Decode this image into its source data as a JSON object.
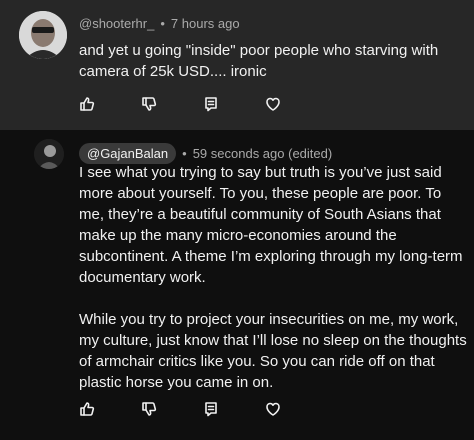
{
  "comments": [
    {
      "username": "@shooterhr_",
      "time": "7 hours ago",
      "paragraphs": [
        "and yet u going \"inside\" poor people who starving with camera of 25k USD.... ironic"
      ],
      "actions": [
        "like-icon",
        "dislike-icon",
        "reply-icon",
        "heart-icon"
      ]
    },
    {
      "username": "@GajanBalan",
      "time": "59 seconds ago (edited)",
      "paragraphs": [
        "I see what you trying to say but truth is you’ve just said more about yourself. To you, these people are poor. To me, they’re a beautiful community of South Asians that make up the many micro-economies around the subcontinent. A theme I’m exploring through my long-term documentary work.",
        "While you try to project your insecurities on me, my work, my culture, just know that I’ll lose no sleep on the thoughts of armchair critics like you. So you can ride off on that plastic horse you came in on."
      ],
      "actions": [
        "like-icon",
        "dislike-icon",
        "reply-icon",
        "heart-icon"
      ]
    }
  ],
  "separator": "•",
  "colors": {
    "first_comment_bg": "#272727",
    "page_bg": "#0f0f0f",
    "meta_text": "#aaaaaa",
    "body_text": "#f1f1f1",
    "handle_pill_bg": "#3a3a3a"
  }
}
